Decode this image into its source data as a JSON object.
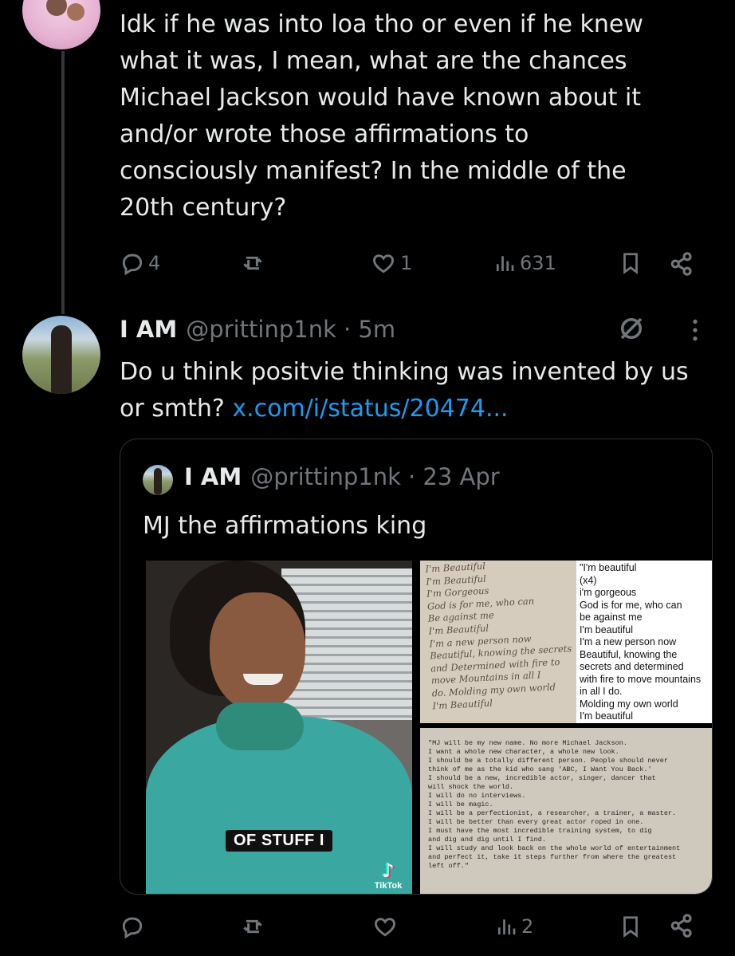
{
  "post1": {
    "text_lines": [
      "Idk if he was into loa tho or even if he knew",
      "what it was, I mean, what are the chances",
      "Michael Jackson would have known about it",
      "and/or wrote those affirmations to",
      "consciously manifest? In the middle of the",
      "20th century?"
    ],
    "actions": {
      "replies": "4",
      "reposts": "",
      "likes": "1",
      "views": "631"
    }
  },
  "post2": {
    "name": "I AM",
    "handle": "@prittinp1nk",
    "time": "· 5m",
    "text": "Do u think positvie thinking was invented by us or smth?",
    "link": "x.com/i/status/20474...",
    "actions": {
      "replies": "",
      "reposts": "",
      "likes": "",
      "views": "2"
    }
  },
  "quote": {
    "name": "I AM",
    "handle": "@prittinp1nk",
    "time": "· 23 Apr",
    "text": "MJ the affirmations king",
    "video_caption": "OF STUFF I",
    "tiktok_label": "TikTok",
    "handwritten_lines": [
      "I'm Beautiful",
      "I'm Beautiful",
      "I'm Gorgeous",
      "God is for me, who can",
      "Be against me",
      "I'm Beautiful",
      "I'm a new person now",
      "Beautiful, knowing the secrets",
      "and Determined with fire to",
      "move Mountains in all I",
      "do. Molding my own world",
      "I'm Beautiful"
    ],
    "transcript_lines": [
      "\"I'm beautiful",
      "(x4)",
      "i'm gorgeous",
      "God is for me, who can",
      "be against me",
      "I'm beautiful",
      "I'm a new person now",
      "Beautiful, knowing the",
      "secrets and determined",
      "with fire to move mountains",
      "in all I do.",
      "Molding my own world",
      "I'm beautiful"
    ],
    "typed_note": "\"MJ will be my new name. No more Michael Jackson.\nI want a whole new character, a whole new look.\nI should be a totally different person. People should never\nthink of me as the kid who sang 'ABC, I Want You Back.'\nI should be a new, incredible actor, singer, dancer that\nwill shock the world.\nI will do no interviews.\nI will be magic.\nI will be a perfectionist, a researcher, a trainer, a master.\nI will be better than every great actor roped in one.\nI must have the most incredible training system, to dig\nand dig and dig until I find.\nI will study and look back on the whole world of entertainment\nand perfect it, take it steps further from where the greatest\nleft off.\""
  },
  "icons": {
    "reply": "reply-icon",
    "repost": "repost-icon",
    "like": "heart-icon",
    "views": "views-icon",
    "bookmark": "bookmark-icon",
    "share": "share-icon",
    "grok": "grok-icon",
    "more": "more-icon"
  },
  "colors": {
    "background": "#000000",
    "text": "#e7e9ea",
    "muted": "#71767b",
    "link": "#1d9bf0",
    "border": "#2f3336"
  }
}
